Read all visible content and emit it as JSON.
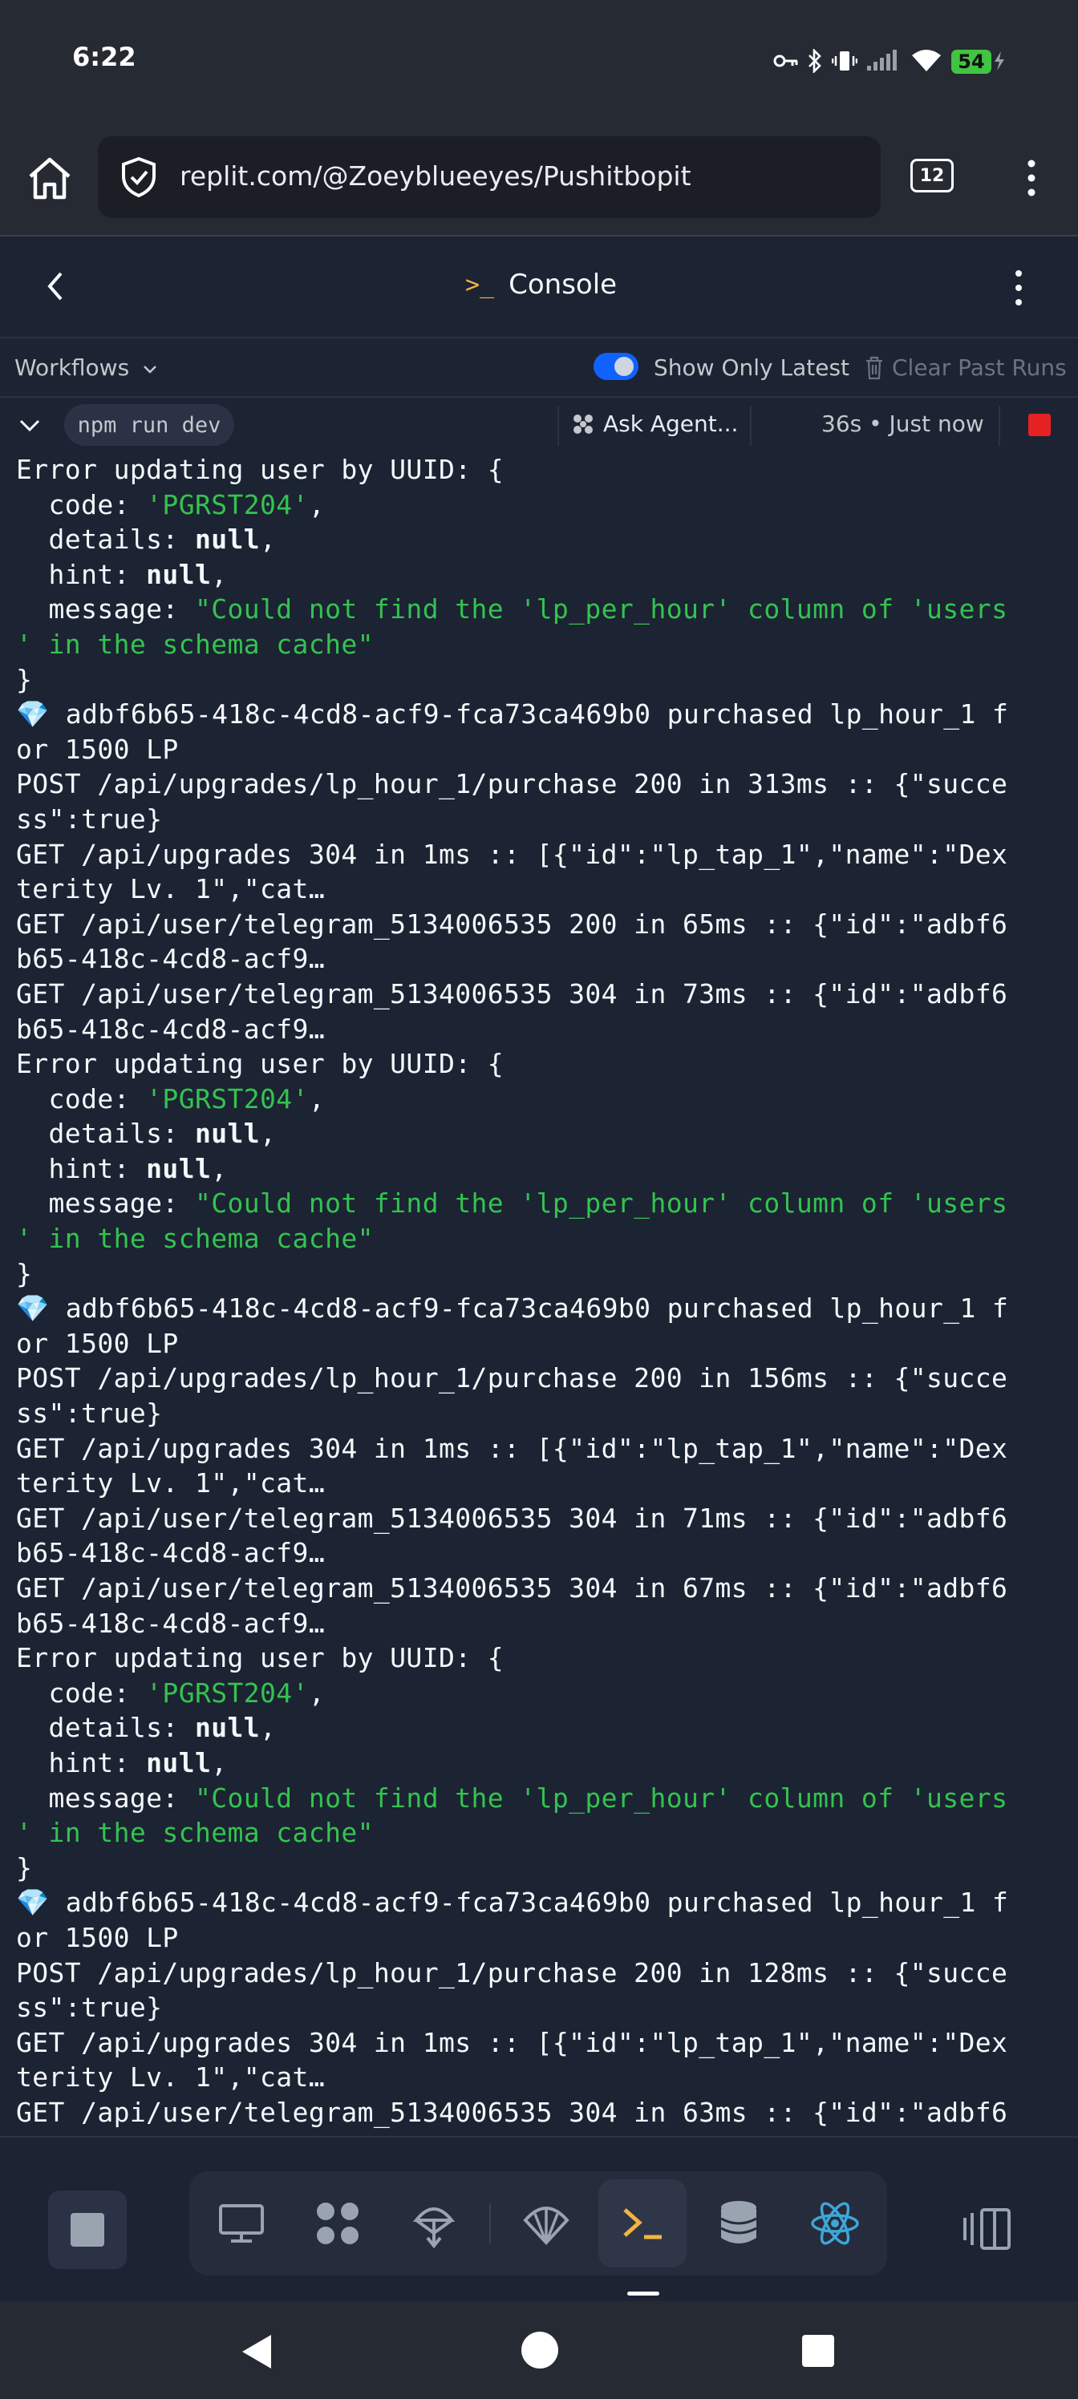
{
  "status_bar": {
    "time": "6:22",
    "battery": "54",
    "icons": [
      "vpn-key-icon",
      "bluetooth-icon",
      "vibrate-icon",
      "signal-icon",
      "wifi-icon",
      "battery-charging-icon"
    ]
  },
  "browser": {
    "url": "replit.com/@Zoeyblueeyes/Pushitbopit",
    "tab_count": "12"
  },
  "header": {
    "title": "Console",
    "prompt_glyph": ">_"
  },
  "workflows": {
    "label": "Workflows",
    "show_only_latest": "Show Only Latest",
    "show_only_latest_on": true,
    "clear_past_runs": "Clear Past Runs"
  },
  "run": {
    "command": "npm run dev",
    "ask_agent": "Ask Agent...",
    "time": "36s • Just now"
  },
  "console_lines": [
    [
      {
        "t": "Error updating user by UUID: {"
      }
    ],
    [
      {
        "t": "  code: "
      },
      {
        "t": "'PGRST204'",
        "c": "g"
      },
      {
        "t": ","
      }
    ],
    [
      {
        "t": "  details: "
      },
      {
        "t": "null",
        "c": "b"
      },
      {
        "t": ","
      }
    ],
    [
      {
        "t": "  hint: "
      },
      {
        "t": "null",
        "c": "b"
      },
      {
        "t": ","
      }
    ],
    [
      {
        "t": "  message: "
      },
      {
        "t": "\"Could not find the 'lp_per_hour' column of 'users",
        "c": "g"
      }
    ],
    [
      {
        "t": "' in the schema cache\"",
        "c": "g"
      }
    ],
    [
      {
        "t": "}"
      }
    ],
    [
      {
        "t": "💎 adbf6b65-418c-4cd8-acf9-fca73ca469b0 purchased lp_hour_1 f"
      }
    ],
    [
      {
        "t": "or 1500 LP"
      }
    ],
    [
      {
        "t": "POST /api/upgrades/lp_hour_1/purchase 200 in 313ms :: {\"succe"
      }
    ],
    [
      {
        "t": "ss\":true}"
      }
    ],
    [
      {
        "t": "GET /api/upgrades 304 in 1ms :: [{\"id\":\"lp_tap_1\",\"name\":\"Dex"
      }
    ],
    [
      {
        "t": "terity Lv. 1\",\"cat…"
      }
    ],
    [
      {
        "t": "GET /api/user/telegram_5134006535 200 in 65ms :: {\"id\":\"adbf6"
      }
    ],
    [
      {
        "t": "b65-418c-4cd8-acf9…"
      }
    ],
    [
      {
        "t": "GET /api/user/telegram_5134006535 304 in 73ms :: {\"id\":\"adbf6"
      }
    ],
    [
      {
        "t": "b65-418c-4cd8-acf9…"
      }
    ],
    [
      {
        "t": "Error updating user by UUID: {"
      }
    ],
    [
      {
        "t": "  code: "
      },
      {
        "t": "'PGRST204'",
        "c": "g"
      },
      {
        "t": ","
      }
    ],
    [
      {
        "t": "  details: "
      },
      {
        "t": "null",
        "c": "b"
      },
      {
        "t": ","
      }
    ],
    [
      {
        "t": "  hint: "
      },
      {
        "t": "null",
        "c": "b"
      },
      {
        "t": ","
      }
    ],
    [
      {
        "t": "  message: "
      },
      {
        "t": "\"Could not find the 'lp_per_hour' column of 'users",
        "c": "g"
      }
    ],
    [
      {
        "t": "' in the schema cache\"",
        "c": "g"
      }
    ],
    [
      {
        "t": "}"
      }
    ],
    [
      {
        "t": "💎 adbf6b65-418c-4cd8-acf9-fca73ca469b0 purchased lp_hour_1 f"
      }
    ],
    [
      {
        "t": "or 1500 LP"
      }
    ],
    [
      {
        "t": "POST /api/upgrades/lp_hour_1/purchase 200 in 156ms :: {\"succe"
      }
    ],
    [
      {
        "t": "ss\":true}"
      }
    ],
    [
      {
        "t": "GET /api/upgrades 304 in 1ms :: [{\"id\":\"lp_tap_1\",\"name\":\"Dex"
      }
    ],
    [
      {
        "t": "terity Lv. 1\",\"cat…"
      }
    ],
    [
      {
        "t": "GET /api/user/telegram_5134006535 304 in 71ms :: {\"id\":\"adbf6"
      }
    ],
    [
      {
        "t": "b65-418c-4cd8-acf9…"
      }
    ],
    [
      {
        "t": "GET /api/user/telegram_5134006535 304 in 67ms :: {\"id\":\"adbf6"
      }
    ],
    [
      {
        "t": "b65-418c-4cd8-acf9…"
      }
    ],
    [
      {
        "t": "Error updating user by UUID: {"
      }
    ],
    [
      {
        "t": "  code: "
      },
      {
        "t": "'PGRST204'",
        "c": "g"
      },
      {
        "t": ","
      }
    ],
    [
      {
        "t": "  details: "
      },
      {
        "t": "null",
        "c": "b"
      },
      {
        "t": ","
      }
    ],
    [
      {
        "t": "  hint: "
      },
      {
        "t": "null",
        "c": "b"
      },
      {
        "t": ","
      }
    ],
    [
      {
        "t": "  message: "
      },
      {
        "t": "\"Could not find the 'lp_per_hour' column of 'users",
        "c": "g"
      }
    ],
    [
      {
        "t": "' in the schema cache\"",
        "c": "g"
      }
    ],
    [
      {
        "t": "}"
      }
    ],
    [
      {
        "t": "💎 adbf6b65-418c-4cd8-acf9-fca73ca469b0 purchased lp_hour_1 f"
      }
    ],
    [
      {
        "t": "or 1500 LP"
      }
    ],
    [
      {
        "t": "POST /api/upgrades/lp_hour_1/purchase 200 in 128ms :: {\"succe"
      }
    ],
    [
      {
        "t": "ss\":true}"
      }
    ],
    [
      {
        "t": "GET /api/upgrades 304 in 1ms :: [{\"id\":\"lp_tap_1\",\"name\":\"Dex"
      }
    ],
    [
      {
        "t": "terity Lv. 1\",\"cat…"
      }
    ],
    [
      {
        "t": "GET /api/user/telegram_5134006535 304 in 63ms :: {\"id\":\"adbf6"
      }
    ]
  ],
  "dock_tools": [
    "preview-icon",
    "agent-icon",
    "deploy-icon",
    "secrets-shell-icon",
    "console-icon",
    "database-icon",
    "react-icon"
  ],
  "colors": {
    "background": "#1c2333",
    "accent_blue": "#0f62fe",
    "log_green": "#33c34f",
    "stop_red": "#e52222",
    "prompt_yellow": "#f2b544"
  }
}
